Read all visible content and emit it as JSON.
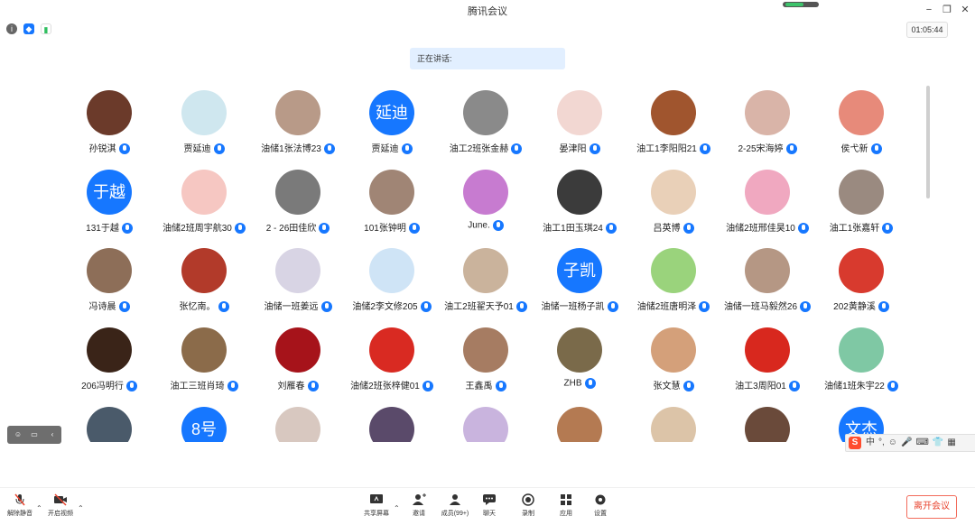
{
  "window": {
    "title": "腾讯会议"
  },
  "toolbar": {
    "timer": "01:05:44"
  },
  "speaking": {
    "label": "正在讲话:"
  },
  "participants": [
    {
      "name": "孙锐淇",
      "avatar_text": "",
      "color": "#6b3a2a"
    },
    {
      "name": "贾延迪",
      "avatar_text": "",
      "color": "#cfe7ef"
    },
    {
      "name": "油储1张法博23",
      "avatar_text": "",
      "color": "#b89a88"
    },
    {
      "name": "贾延迪",
      "avatar_text": "延迪",
      "color": "#1677ff"
    },
    {
      "name": "油工2班张金赫",
      "avatar_text": "",
      "color": "#8a8a8a"
    },
    {
      "name": "晏津阳",
      "avatar_text": "",
      "color": "#f2d7d2"
    },
    {
      "name": "油工1李阳阳21",
      "avatar_text": "",
      "color": "#a0552e"
    },
    {
      "name": "2-25宋海婷",
      "avatar_text": "",
      "color": "#d9b4a8"
    },
    {
      "name": "侯弋新",
      "avatar_text": "",
      "color": "#e78a7a"
    },
    {
      "name": "131于越",
      "avatar_text": "于越",
      "color": "#1677ff"
    },
    {
      "name": "油储2班周宇航30",
      "avatar_text": "",
      "color": "#f6c7c2"
    },
    {
      "name": "2 - 26田佳欣",
      "avatar_text": "",
      "color": "#7a7a7a"
    },
    {
      "name": "101张钟明",
      "avatar_text": "",
      "color": "#a08575"
    },
    {
      "name": "June.",
      "avatar_text": "",
      "color": "#c77bd0"
    },
    {
      "name": "油工1田玉琪24",
      "avatar_text": "",
      "color": "#3b3b3b"
    },
    {
      "name": "吕英博",
      "avatar_text": "",
      "color": "#e9d0b8"
    },
    {
      "name": "油储2班邢佳昊10",
      "avatar_text": "",
      "color": "#f0a8c0"
    },
    {
      "name": "油工1张嘉轩",
      "avatar_text": "",
      "color": "#9a8a80"
    },
    {
      "name": "冯诗晨",
      "avatar_text": "",
      "color": "#8d6e58"
    },
    {
      "name": "张忆南。",
      "avatar_text": "",
      "color": "#b23a2a"
    },
    {
      "name": "油储一班姜远",
      "avatar_text": "",
      "color": "#d8d4e4"
    },
    {
      "name": "油储2李文修205",
      "avatar_text": "",
      "color": "#cfe4f6"
    },
    {
      "name": "油工2班翟天予01",
      "avatar_text": "",
      "color": "#cab39c"
    },
    {
      "name": "油储一班杨子凯",
      "avatar_text": "子凯",
      "color": "#1677ff"
    },
    {
      "name": "油储2班唐明泽",
      "avatar_text": "",
      "color": "#9ad37c"
    },
    {
      "name": "油储一班马毅然26",
      "avatar_text": "",
      "color": "#b59784"
    },
    {
      "name": "202黄静溪",
      "avatar_text": "",
      "color": "#d83a2e"
    },
    {
      "name": "206冯明行",
      "avatar_text": "",
      "color": "#3a2418"
    },
    {
      "name": "油工三班肖琦",
      "avatar_text": "",
      "color": "#8b6b4a"
    },
    {
      "name": "刘雁春",
      "avatar_text": "",
      "color": "#a6131a"
    },
    {
      "name": "油储2班张梓健01",
      "avatar_text": "",
      "color": "#d92a22"
    },
    {
      "name": "王鑫禹",
      "avatar_text": "",
      "color": "#a67c62"
    },
    {
      "name": "ZHB",
      "avatar_text": "",
      "color": "#7a6a4a"
    },
    {
      "name": "张文慧",
      "avatar_text": "",
      "color": "#d4a07a"
    },
    {
      "name": "油工3周阳01",
      "avatar_text": "",
      "color": "#d8281e"
    },
    {
      "name": "油储1班朱宇22",
      "avatar_text": "",
      "color": "#7fc8a4"
    },
    {
      "name": "",
      "avatar_text": "",
      "color": "#4a5a6a"
    },
    {
      "name": "",
      "avatar_text": "8号",
      "color": "#1677ff"
    },
    {
      "name": "",
      "avatar_text": "",
      "color": "#d8c8c0"
    },
    {
      "name": "",
      "avatar_text": "",
      "color": "#5a4a6a"
    },
    {
      "name": "",
      "avatar_text": "",
      "color": "#c9b4de"
    },
    {
      "name": "",
      "avatar_text": "",
      "color": "#b47a52"
    },
    {
      "name": "",
      "avatar_text": "",
      "color": "#dcc4a8"
    },
    {
      "name": "",
      "avatar_text": "",
      "color": "#6a4a3a"
    },
    {
      "name": "",
      "avatar_text": "文杰",
      "color": "#1677ff"
    }
  ],
  "ime": {
    "items": [
      "中",
      "°,",
      "☺",
      "🎤",
      "⌨",
      "👕",
      "▦"
    ]
  },
  "bottom": {
    "unmute": "解除静音",
    "video": "开启视频",
    "share": "共享屏幕",
    "invite": "邀请",
    "members": "成员(99+)",
    "chat": "聊天",
    "record": "录制",
    "apps": "应用",
    "settings": "设置",
    "leave": "离开会议"
  }
}
